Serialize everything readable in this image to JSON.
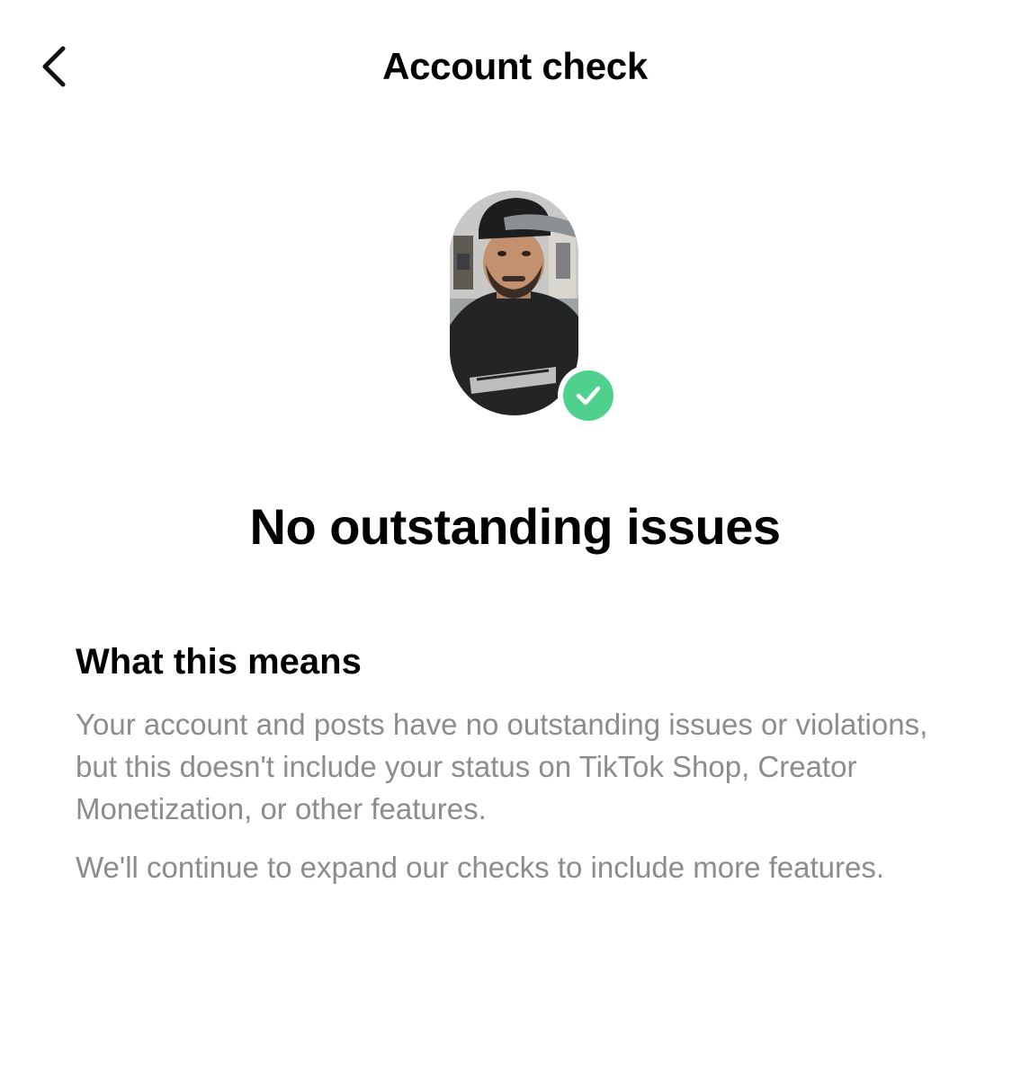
{
  "header": {
    "title": "Account check",
    "back_icon": "chevron-left-icon"
  },
  "avatar": {
    "description": "profile-photo",
    "status_icon": "check-circle-icon",
    "status_color": "#4fd08d"
  },
  "status": {
    "headline": "No outstanding issues"
  },
  "details": {
    "title": "What this means",
    "paragraph_1": "Your account and posts have no outstanding issues or violations, but this doesn't include your status on TikTok Shop, Creator Monetization, or other features.",
    "paragraph_2": "We'll continue to expand our checks to include more features."
  },
  "colors": {
    "background": "#ffffff",
    "text_primary": "#000000",
    "text_secondary": "#8c8c8c",
    "success": "#4fd08d"
  }
}
